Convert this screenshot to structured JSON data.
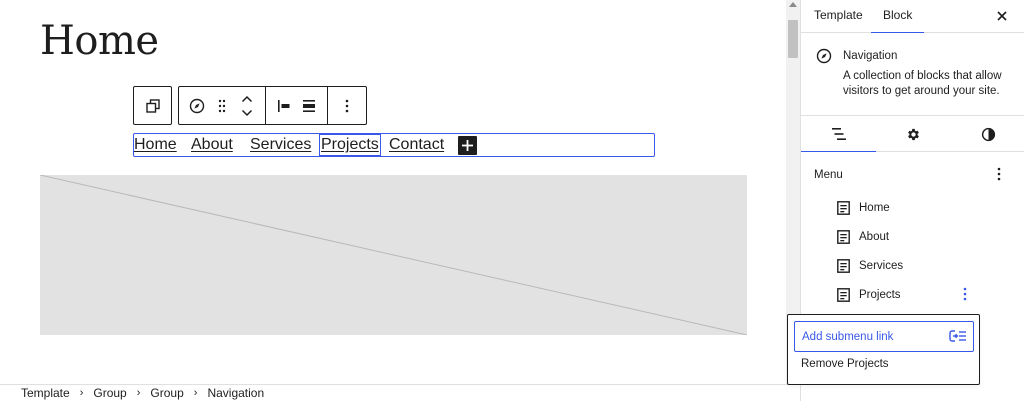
{
  "editor": {
    "page_title": "Home",
    "navigation": {
      "items": [
        {
          "label": "Home"
        },
        {
          "label": "About"
        },
        {
          "label": "Services"
        },
        {
          "label": "Projects"
        },
        {
          "label": "Contact"
        }
      ],
      "add_icon": "plus-icon"
    },
    "toolbar": {
      "icons": [
        "transform-icon",
        "compass-icon",
        "drag-handle-icon",
        "move-up-icon",
        "move-down-icon",
        "justify-left-icon",
        "width-icon",
        "more-options-icon"
      ]
    }
  },
  "breadcrumb": {
    "items": [
      "Template",
      "Group",
      "Group",
      "Navigation"
    ]
  },
  "sidebar": {
    "tabs": {
      "template": "Template",
      "block": "Block"
    },
    "active_tab": "Block",
    "block_card": {
      "title": "Navigation",
      "description": "A collection of blocks that allow visitors to get around your site."
    },
    "sub_tabs": [
      "list-view-icon",
      "settings-gear-icon",
      "styles-half-circle-icon"
    ],
    "menu": {
      "label": "Menu",
      "items": [
        {
          "label": "Home"
        },
        {
          "label": "About"
        },
        {
          "label": "Services"
        },
        {
          "label": "Projects"
        }
      ]
    },
    "popover": {
      "add_submenu": "Add submenu link",
      "remove": "Remove Projects"
    }
  },
  "colors": {
    "accent": "#3858e9",
    "text": "#1e1e1e",
    "placeholder_bg": "#e2e2e2"
  }
}
